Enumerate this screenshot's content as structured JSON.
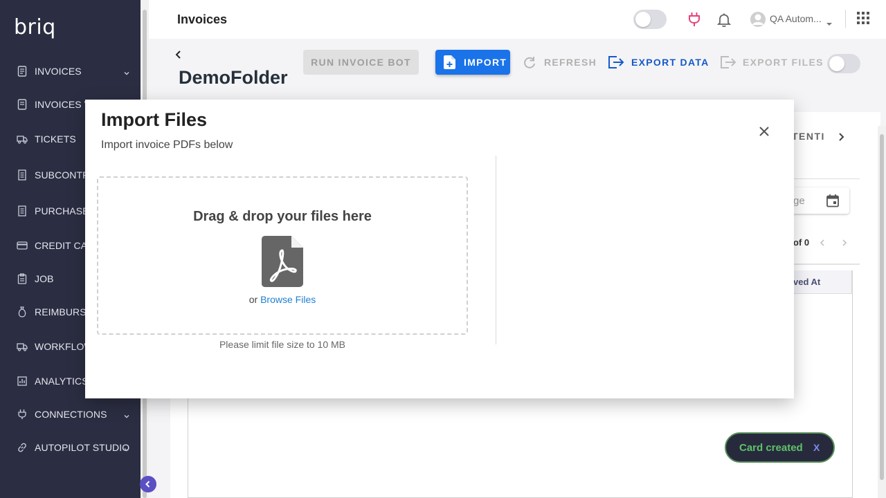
{
  "app": {
    "logo": "briq",
    "page_title": "Invoices"
  },
  "sidebar": {
    "items": [
      {
        "label": "INVOICES",
        "icon": "document-icon",
        "has_chevron": true
      },
      {
        "label": "INVOICES V",
        "icon": "document-icon",
        "has_chevron": false
      },
      {
        "label": "TICKETS",
        "icon": "truck-icon",
        "has_chevron": false
      },
      {
        "label": "SUBCONTRA",
        "icon": "building-icon",
        "has_chevron": false
      },
      {
        "label": "PURCHASE",
        "icon": "receipt-icon",
        "has_chevron": false
      },
      {
        "label": "CREDIT CAR",
        "icon": "credit-card-icon",
        "has_chevron": false
      },
      {
        "label": "JOB",
        "icon": "clipboard-icon",
        "has_chevron": false
      },
      {
        "label": "REIMBURSE",
        "icon": "money-bag-icon",
        "has_chevron": false
      },
      {
        "label": "WORKFLOW",
        "icon": "truck-icon",
        "has_chevron": false
      },
      {
        "label": "ANALYTICS",
        "icon": "chart-icon",
        "has_chevron": false
      },
      {
        "label": "CONNECTIONS",
        "icon": "plug-icon",
        "has_chevron": true
      },
      {
        "label": "AUTOPILOT STUDIO",
        "icon": "link-icon",
        "has_chevron": true
      }
    ]
  },
  "header": {
    "user_name": "QA Autom...",
    "toggle_on": false
  },
  "folder": {
    "name": "DemoFolder"
  },
  "toolbar": {
    "run_bot": "RUN INVOICE BOT",
    "import": "IMPORT",
    "refresh": "REFRESH",
    "export_data": "EXPORT DATA",
    "export_files": "EXPORT FILES"
  },
  "background": {
    "tab_fragment": "TENTI",
    "date_placeholder_fragment": "ge",
    "pagination_fragment": "of 0",
    "column_header_fragment": "ved At"
  },
  "modal": {
    "title": "Import Files",
    "subtitle": "Import invoice PDFs below",
    "dropzone_title": "Drag & drop your files here",
    "or_text": "or",
    "browse_link": "Browse Files",
    "file_limit": "Please limit file size to 10 MB"
  },
  "toast": {
    "message": "Card created",
    "close": "X"
  },
  "colors": {
    "sidebar_bg": "#2b2d42",
    "primary": "#1a73e8",
    "export_text": "#1559c7",
    "plug_icon": "#e8407a",
    "toast_text": "#5fc26a"
  }
}
